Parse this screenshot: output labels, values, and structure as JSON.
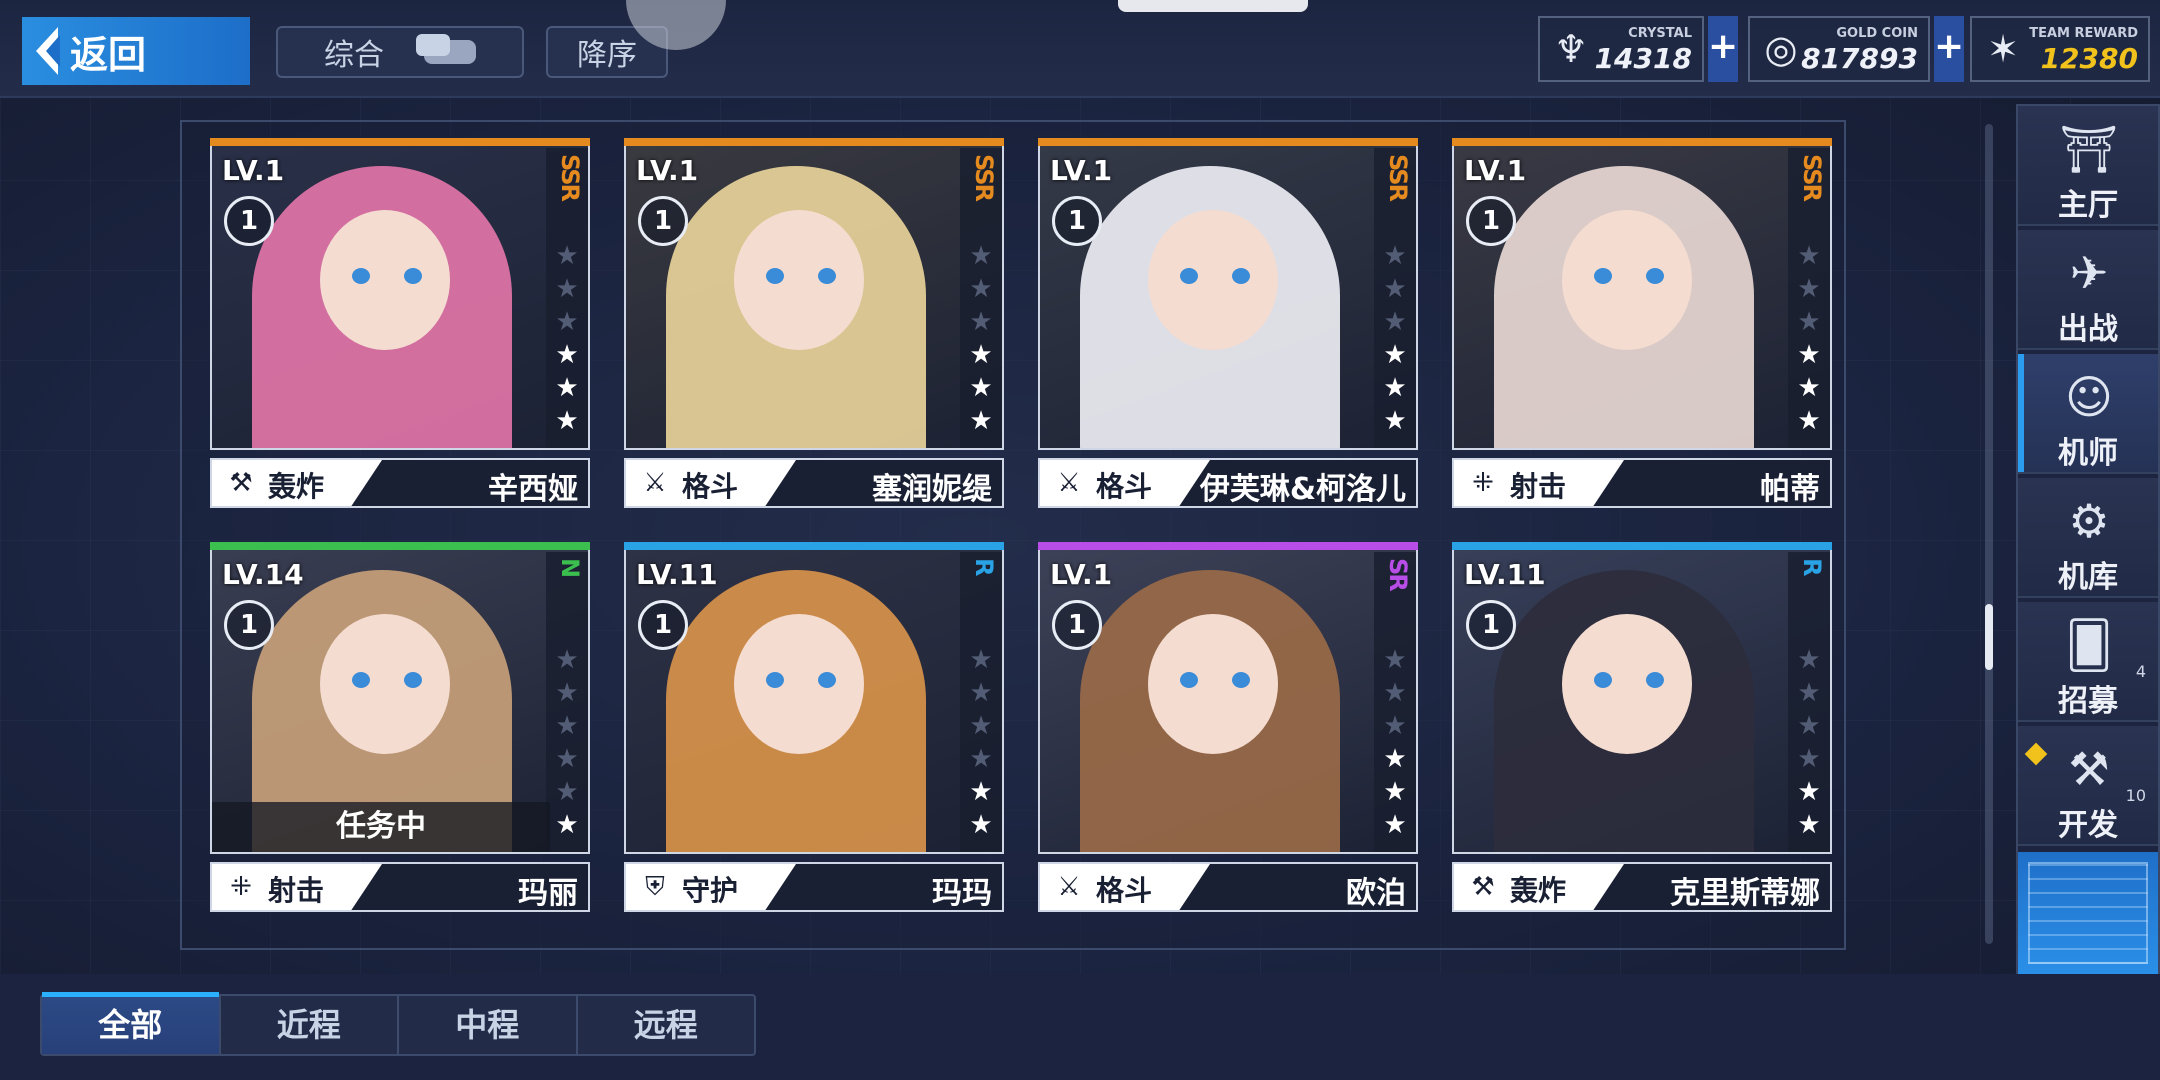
{
  "header": {
    "back_label": "返回",
    "sort_filter_label": "综合",
    "order_label": "降序"
  },
  "currencies": [
    {
      "label": "CRYSTAL",
      "value": "14318",
      "icon": "crystal-icon"
    },
    {
      "label": "GOLD COIN",
      "value": "817893",
      "icon": "gold-coin-icon"
    },
    {
      "label": "TEAM REWARD",
      "value": "12380",
      "icon": "team-reward-icon"
    }
  ],
  "colors": {
    "ssr": "#e58a1e",
    "sr": "#b84de8",
    "r": "#2aa3e6",
    "n": "#3bbf4e",
    "accent": "#2a9df0",
    "gold": "#f2c21c"
  },
  "cards": [
    {
      "level": "LV.1",
      "badge": "1",
      "rarity": "SSR",
      "stars": 3,
      "role": "轰炸",
      "role_icon": "bomber-icon",
      "name": "辛西娅",
      "status": ""
    },
    {
      "level": "LV.1",
      "badge": "1",
      "rarity": "SSR",
      "stars": 3,
      "role": "格斗",
      "role_icon": "melee-swords-icon",
      "name": "塞润妮缇",
      "status": ""
    },
    {
      "level": "LV.1",
      "badge": "1",
      "rarity": "SSR",
      "stars": 3,
      "role": "格斗",
      "role_icon": "melee-swords-icon",
      "name": "伊芙琳&柯洛儿",
      "status": ""
    },
    {
      "level": "LV.1",
      "badge": "1",
      "rarity": "SSR",
      "stars": 3,
      "role": "射击",
      "role_icon": "rifle-icon",
      "name": "帕蒂",
      "status": ""
    },
    {
      "level": "LV.14",
      "badge": "1",
      "rarity": "N",
      "stars": 1,
      "role": "射击",
      "role_icon": "rifle-icon",
      "name": "玛丽",
      "status": "任务中"
    },
    {
      "level": "LV.11",
      "badge": "1",
      "rarity": "R",
      "stars": 2,
      "role": "守护",
      "role_icon": "shield-icon",
      "name": "玛玛",
      "status": ""
    },
    {
      "level": "LV.1",
      "badge": "1",
      "rarity": "SR",
      "stars": 3,
      "role": "格斗",
      "role_icon": "melee-swords-icon",
      "name": "欧泊",
      "status": ""
    },
    {
      "level": "LV.11",
      "badge": "1",
      "rarity": "R",
      "stars": 2,
      "role": "轰炸",
      "role_icon": "bomber-icon",
      "name": "克里斯蒂娜",
      "status": ""
    }
  ],
  "sidebar": {
    "items": [
      {
        "label": "主厅",
        "icon": "hall-icon"
      },
      {
        "label": "出战",
        "icon": "sortie-icon"
      },
      {
        "label": "机师",
        "icon": "pilot-icon",
        "active": true
      },
      {
        "label": "机库",
        "icon": "hangar-icon"
      },
      {
        "label": "招募",
        "icon": "recruit-card-icon",
        "count": "4"
      },
      {
        "label": "开发",
        "icon": "develop-icon",
        "count": "10"
      }
    ]
  },
  "bottom_tabs": [
    {
      "label": "全部",
      "active": true
    },
    {
      "label": "近程"
    },
    {
      "label": "中程"
    },
    {
      "label": "远程"
    }
  ]
}
